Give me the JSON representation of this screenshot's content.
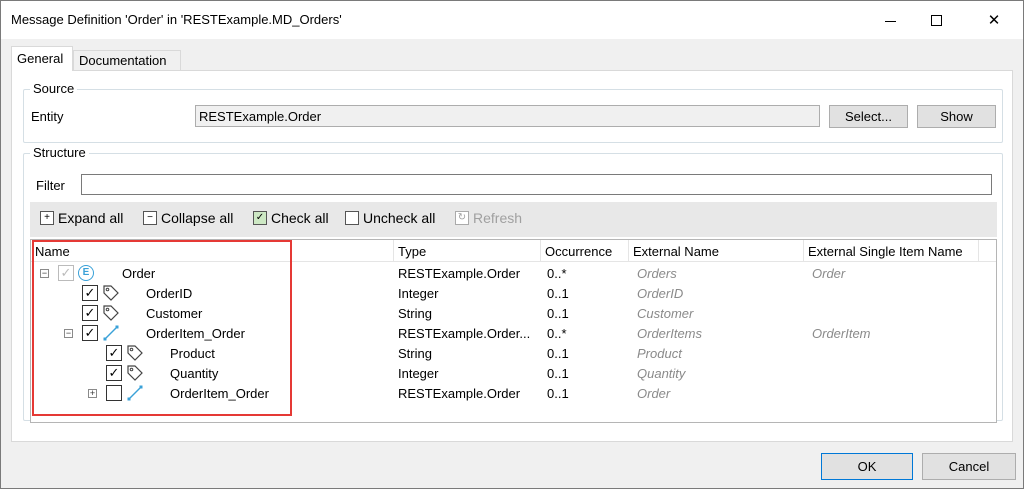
{
  "window": {
    "title": "Message Definition 'Order' in 'RESTExample.MD_Orders'",
    "min_glyph": "—",
    "close_glyph": "✕"
  },
  "tabs": [
    {
      "label": "General",
      "active": true
    },
    {
      "label": "Documentation",
      "active": false
    }
  ],
  "source": {
    "legend": "Source",
    "entity_label": "Entity",
    "entity_value": "RESTExample.Order",
    "select_label": "Select...",
    "show_label": "Show"
  },
  "structure": {
    "legend": "Structure",
    "filter_label": "Filter",
    "filter_value": "",
    "toolbar": {
      "expand_all": "Expand all",
      "collapse_all": "Collapse all",
      "check_all": "Check all",
      "uncheck_all": "Uncheck all",
      "refresh": "Refresh"
    },
    "columns": {
      "name": "Name",
      "type": "Type",
      "occurrence": "Occurrence",
      "external_name": "External Name",
      "external_single": "External Single Item Name"
    },
    "rows": [
      {
        "name": "Order",
        "type": "RESTExample.Order",
        "occurrence": "0..*",
        "external_name": "Orders",
        "external_single": "Order",
        "checked": true,
        "icon": "entity-icon",
        "expander": "minus"
      },
      {
        "name": "OrderID",
        "type": "Integer",
        "occurrence": "0..1",
        "external_name": "OrderID",
        "external_single": "",
        "checked": true,
        "icon": "attribute-tag-icon"
      },
      {
        "name": "Customer",
        "type": "String",
        "occurrence": "0..1",
        "external_name": "Customer",
        "external_single": "",
        "checked": true,
        "icon": "attribute-tag-icon"
      },
      {
        "name": "OrderItem_Order",
        "type": "RESTExample.Order...",
        "occurrence": "0..*",
        "external_name": "OrderItems",
        "external_single": "OrderItem",
        "checked": true,
        "icon": "association-icon",
        "expander": "minus"
      },
      {
        "name": "Product",
        "type": "String",
        "occurrence": "0..1",
        "external_name": "Product",
        "external_single": "",
        "checked": true,
        "icon": "attribute-tag-icon"
      },
      {
        "name": "Quantity",
        "type": "Integer",
        "occurrence": "0..1",
        "external_name": "Quantity",
        "external_single": "",
        "checked": true,
        "icon": "attribute-tag-icon"
      },
      {
        "name": "OrderItem_Order",
        "type": "RESTExample.Order",
        "occurrence": "0..1",
        "external_name": "Order",
        "external_single": "",
        "checked": false,
        "icon": "association-icon",
        "expander": "plus"
      }
    ]
  },
  "footer": {
    "ok_label": "OK",
    "cancel_label": "Cancel"
  },
  "colors": {
    "highlight": "#e53935",
    "accent": "#0078d7"
  }
}
